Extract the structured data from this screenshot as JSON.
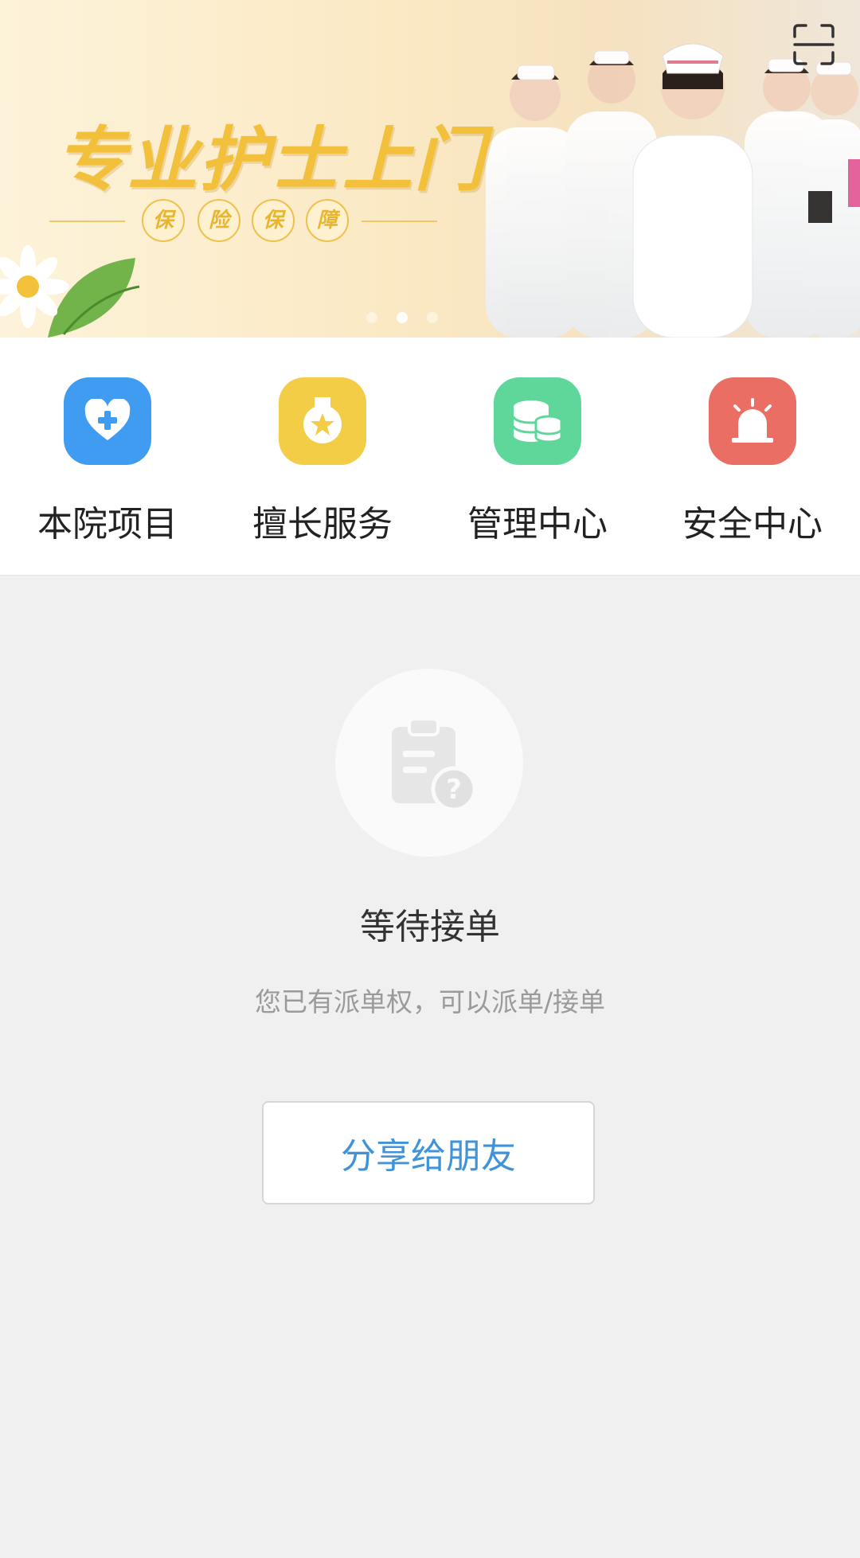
{
  "banner": {
    "title": "专业护士上门",
    "badges": [
      "保",
      "险",
      "保",
      "障"
    ],
    "slides_total": 3,
    "active_slide": 2
  },
  "nav": {
    "items": [
      {
        "label": "本院项目",
        "icon": "heart-plus-icon",
        "color": "#3f9cf1"
      },
      {
        "label": "擅长服务",
        "icon": "medal-icon",
        "color": "#f3cd45"
      },
      {
        "label": "管理中心",
        "icon": "database-icon",
        "color": "#5fd79b"
      },
      {
        "label": "安全中心",
        "icon": "alarm-light-icon",
        "color": "#ea6e63"
      }
    ]
  },
  "empty_state": {
    "icon": "clipboard-question-icon",
    "title": "等待接单",
    "subtitle": "您已有派单权，可以派单/接单"
  },
  "share_button": {
    "label": "分享给朋友",
    "color": "#3f93d8"
  }
}
